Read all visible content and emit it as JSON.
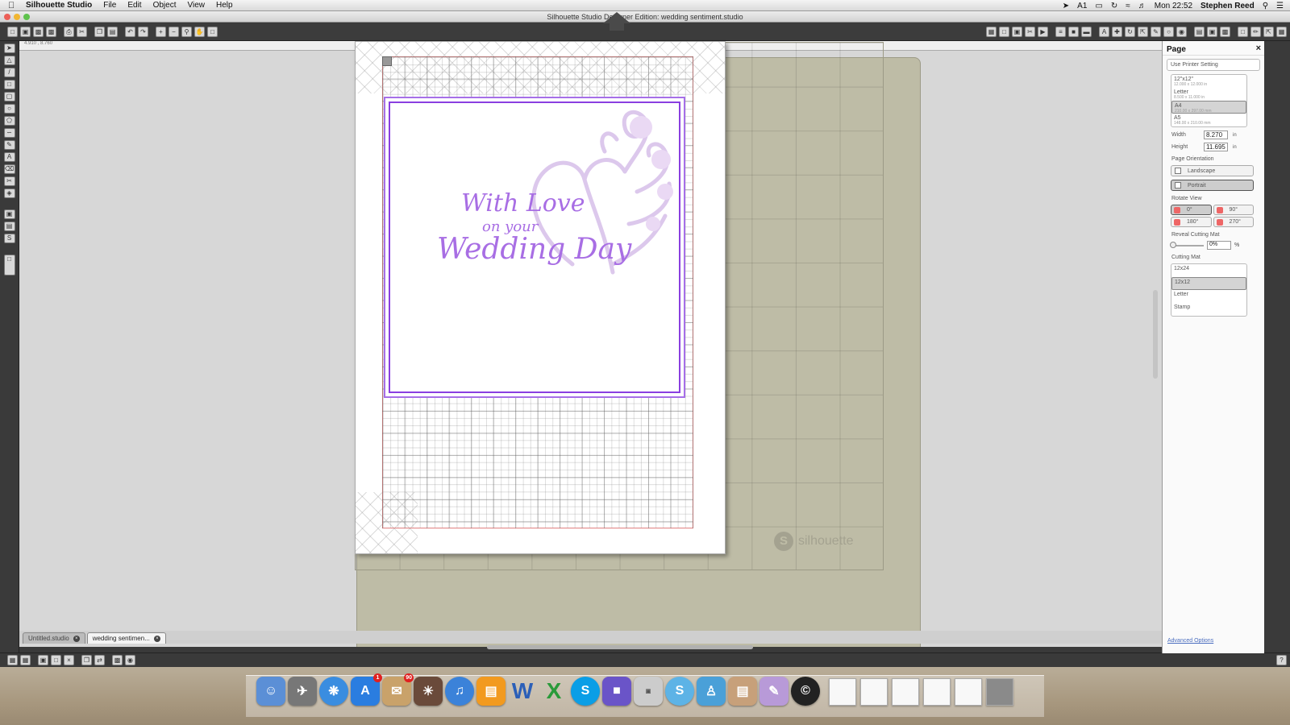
{
  "menubar": {
    "app_name": "Silhouette Studio",
    "menus": [
      "File",
      "Edit",
      "Object",
      "View",
      "Help"
    ],
    "clock": "Mon 22:52",
    "user": "Stephen Reed",
    "status_text": "1"
  },
  "window": {
    "title": "Silhouette Studio Designer Edition: wedding sentiment.studio"
  },
  "ruler": {
    "readout": "4.910 , 8.760"
  },
  "design": {
    "line1": "With Love",
    "line2": "on your",
    "line3": "Wedding Day",
    "text_color": "#a86ee4",
    "border_color": "#8a3fe0"
  },
  "mat": {
    "brand": "silhouette",
    "color": "#bebca6"
  },
  "tabs": [
    {
      "label": "Untitled.studio"
    },
    {
      "label": "wedding sentimen..."
    }
  ],
  "panel": {
    "title": "Page",
    "use_printer": "Use Printer Setting",
    "sizes": [
      {
        "name": "12\"x12\"",
        "dims": "12.000 x 12.000 in"
      },
      {
        "name": "Letter",
        "dims": "8.500 x 11.000 in"
      },
      {
        "name": "A4",
        "dims": "210.00 x 297.00 mm"
      },
      {
        "name": "A5",
        "dims": "148.00 x 210.00 mm"
      }
    ],
    "width_label": "Width",
    "width_value": "8.270",
    "height_label": "Height",
    "height_value": "11.695",
    "unit": "in",
    "orientation_label": "Page Orientation",
    "landscape": "Landscape",
    "portrait": "Portrait",
    "rotate_label": "Rotate View",
    "rot0": "0°",
    "rot90": "90°",
    "rot180": "180°",
    "rot270": "270°",
    "reveal_label": "Reveal Cutting Mat",
    "reveal_value": "0%",
    "percent": "%",
    "mat_label": "Cutting Mat",
    "mats": [
      "12x24",
      "12x12",
      "Letter",
      "Stamp"
    ],
    "advanced": "Advanced Options"
  }
}
